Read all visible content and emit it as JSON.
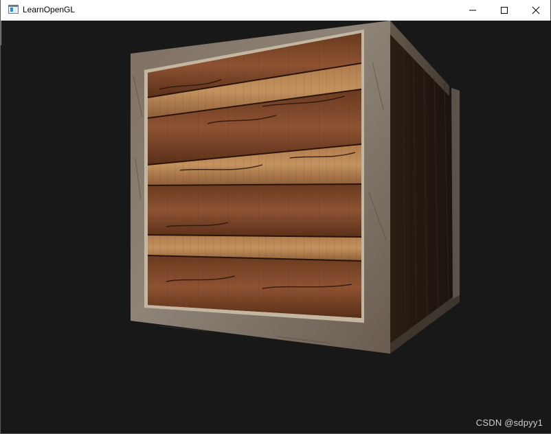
{
  "window": {
    "title": "LearnOpenGL",
    "app_icon": "app-window-icon",
    "controls": {
      "minimize_icon": "minimize-icon",
      "maximize_icon": "maximize-icon",
      "close_icon": "close-icon"
    }
  },
  "scene": {
    "object": "textured wooden crate",
    "background_color": "#181818"
  },
  "watermark": "CSDN @sdpyy1"
}
